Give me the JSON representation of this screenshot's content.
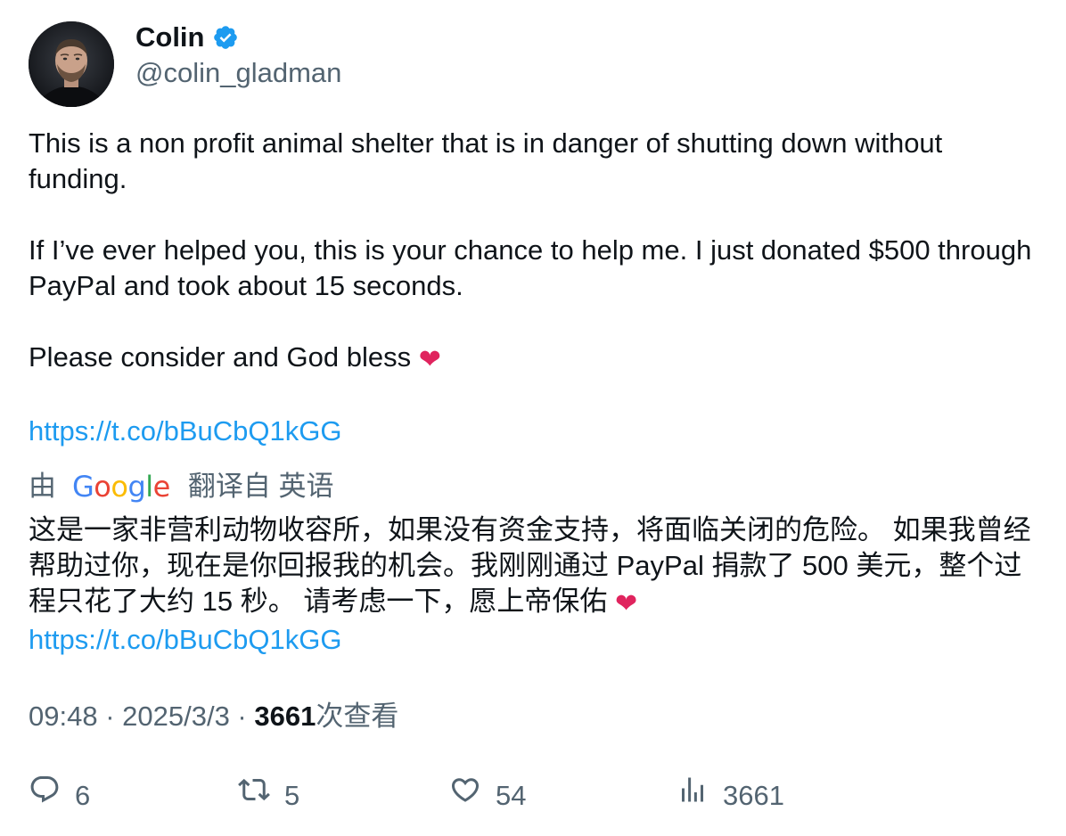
{
  "author": {
    "display_name": "Colin",
    "handle": "@colin_gladman",
    "verified": true,
    "verified_color": "#1d9bf0"
  },
  "tweet": {
    "paragraph1": "This is a non profit animal shelter that is in danger of shutting down without funding.",
    "paragraph2": "If I’ve ever helped you, this is your chance to help me. I just donated $500 through PayPal and took about 15 seconds.",
    "paragraph3": "Please consider and God bless",
    "heart_emoji": "❤",
    "link": "https://t.co/bBuCbQ1kGG"
  },
  "translation": {
    "prefix": "由",
    "provider_logo": "Google",
    "suffix": "翻译自 英语",
    "text": "这是一家非营利动物收容所，如果没有资金支持，将面临关闭的危险。 如果我曾经帮助过你，现在是你回报我的机会。我刚刚通过 PayPal 捐款了 500 美元，整个过程只花了大约 15 秒。 请考虑一下，愿上帝保佑",
    "heart_emoji": "❤",
    "link": "https://t.co/bBuCbQ1kGG"
  },
  "meta": {
    "time": "09:48",
    "separator": " · ",
    "date": "2025/3/3",
    "views_count": "3661",
    "views_label": "次查看"
  },
  "actions": {
    "replies": "6",
    "retweets": "5",
    "likes": "54",
    "views": "3661"
  },
  "colors": {
    "link": "#1d9bf0",
    "secondary_text": "#536471",
    "primary_text": "#0f1419",
    "heart": "#e0245e"
  },
  "icons": {
    "reply": "reply-icon",
    "retweet": "retweet-icon",
    "like": "heart-icon",
    "views": "analytics-icon"
  }
}
